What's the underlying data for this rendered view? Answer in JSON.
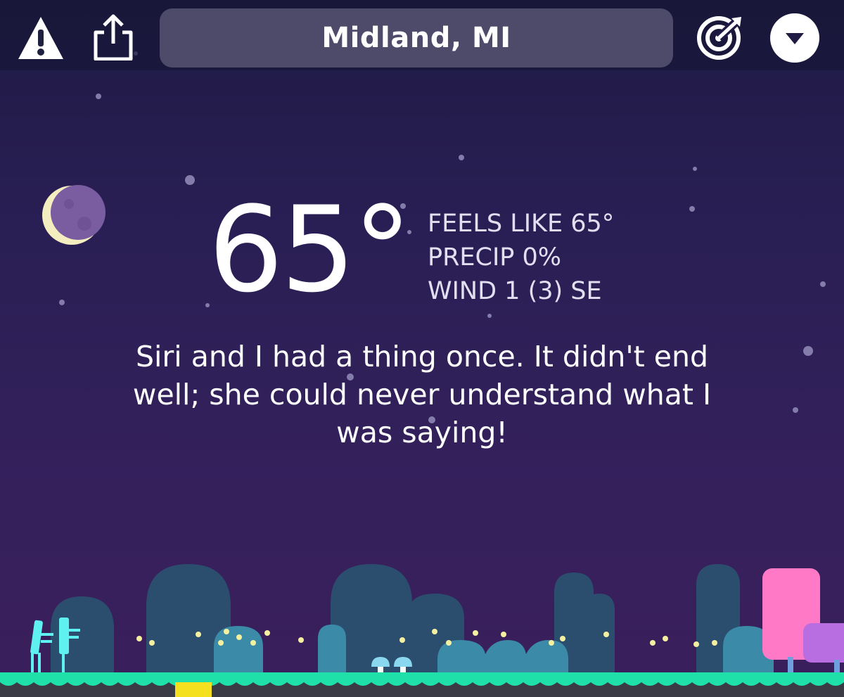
{
  "header": {
    "location": "Midland, MI",
    "left_icons": [
      "warning-icon",
      "share-icon"
    ],
    "right_icons": [
      "radar-icon",
      "dropdown-icon"
    ]
  },
  "weather": {
    "temperature": "65°",
    "feels_like": "FEELS LIKE 65°",
    "precip": "PRECIP 0%",
    "wind": "WIND 1 (3) SE",
    "condition_icon": "crescent-moon-icon"
  },
  "message": "Siri and I had a thing once. It didn't end well; she could never understand what I was saying!",
  "colors": {
    "sky_top": "#1f1b45",
    "sky_bottom": "#3a1f5c",
    "ground_green": "#1fe0a8",
    "tree_blue": "#2c4e6e",
    "bush_teal": "#3a8aa8",
    "pink_tree": "#ff79c6",
    "purple_tree": "#b86ee0",
    "firefly_yellow": "#f5f0a0"
  }
}
